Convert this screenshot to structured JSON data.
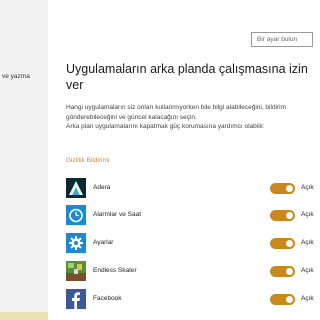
{
  "sidebar": {
    "partial_item": "ve yazma"
  },
  "search": {
    "placeholder": "Bir ayar bulun"
  },
  "page": {
    "title": "Uygulamaların arka planda çalışmasına izin ver",
    "paragraph1": "Hangi uygulamaların siz onları kullanmıyorken bile bilgi alabileceğini, bildirim gönderebileceğini ve güncel kalacağını seçin.",
    "paragraph2": "Arka plan uygulamalarını kapatmak güç korumasına yardımcı olabilir.",
    "privacy_link": "Gizlilik Bildirimi"
  },
  "apps": [
    {
      "name": "Adera",
      "icon": "adera-icon",
      "toggle": "Açık",
      "on": true
    },
    {
      "name": "Alarmlar ve Saat",
      "icon": "alarm-clock-icon",
      "toggle": "Açık",
      "on": true
    },
    {
      "name": "Ayarlar",
      "icon": "gear-icon",
      "toggle": "Açık",
      "on": true
    },
    {
      "name": "Endless Skater",
      "icon": "skater-game-icon",
      "toggle": "Açık",
      "on": true
    },
    {
      "name": "Facebook",
      "icon": "facebook-icon",
      "toggle": "Açık",
      "on": true
    }
  ],
  "colors": {
    "accent": "#c8881c",
    "link": "#d08a2a",
    "settings_tile": "#1b8ad3",
    "facebook": "#3b5998"
  }
}
